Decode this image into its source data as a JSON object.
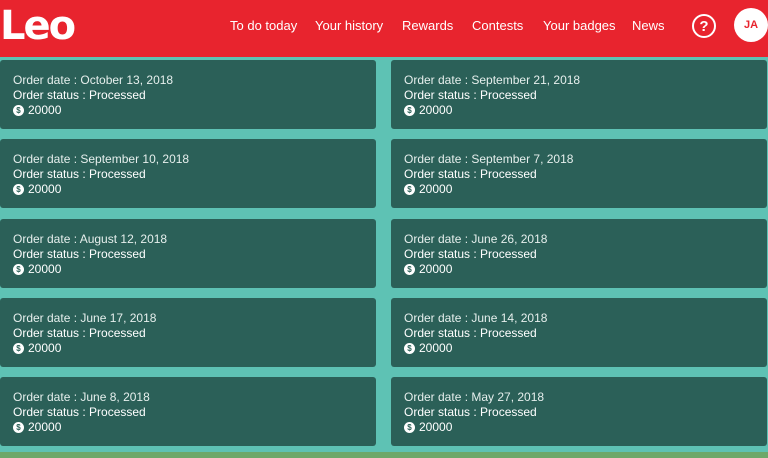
{
  "header": {
    "logo_text": "Leo",
    "nav": [
      {
        "label": "To do today"
      },
      {
        "label": "Your history"
      },
      {
        "label": "Rewards"
      },
      {
        "label": "Contests"
      },
      {
        "label": "Your badges"
      },
      {
        "label": "News"
      }
    ],
    "help_symbol": "?",
    "avatar_initials": "JA"
  },
  "orders": [
    {
      "date_label": "Order date : October 13, 2018",
      "status_label": "Order status : Processed",
      "amount": "20000"
    },
    {
      "date_label": "Order date : September 21, 2018",
      "status_label": "Order status : Processed",
      "amount": "20000"
    },
    {
      "date_label": "Order date : September 10, 2018",
      "status_label": "Order status : Processed",
      "amount": "20000"
    },
    {
      "date_label": "Order date : September 7, 2018",
      "status_label": "Order status : Processed",
      "amount": "20000"
    },
    {
      "date_label": "Order date : August 12, 2018",
      "status_label": "Order status : Processed",
      "amount": "20000"
    },
    {
      "date_label": "Order date : June 26, 2018",
      "status_label": "Order status : Processed",
      "amount": "20000"
    },
    {
      "date_label": "Order date : June 17, 2018",
      "status_label": "Order status : Processed",
      "amount": "20000"
    },
    {
      "date_label": "Order date : June 14, 2018",
      "status_label": "Order status : Processed",
      "amount": "20000"
    },
    {
      "date_label": "Order date : June 8, 2018",
      "status_label": "Order status : Processed",
      "amount": "20000"
    },
    {
      "date_label": "Order date : May 27, 2018",
      "status_label": "Order status : Processed",
      "amount": "20000"
    }
  ],
  "currency_symbol": "$",
  "colors": {
    "brand_red": "#e8242e",
    "page_background": "#5ec2b4",
    "card_background": "#2b6058"
  }
}
